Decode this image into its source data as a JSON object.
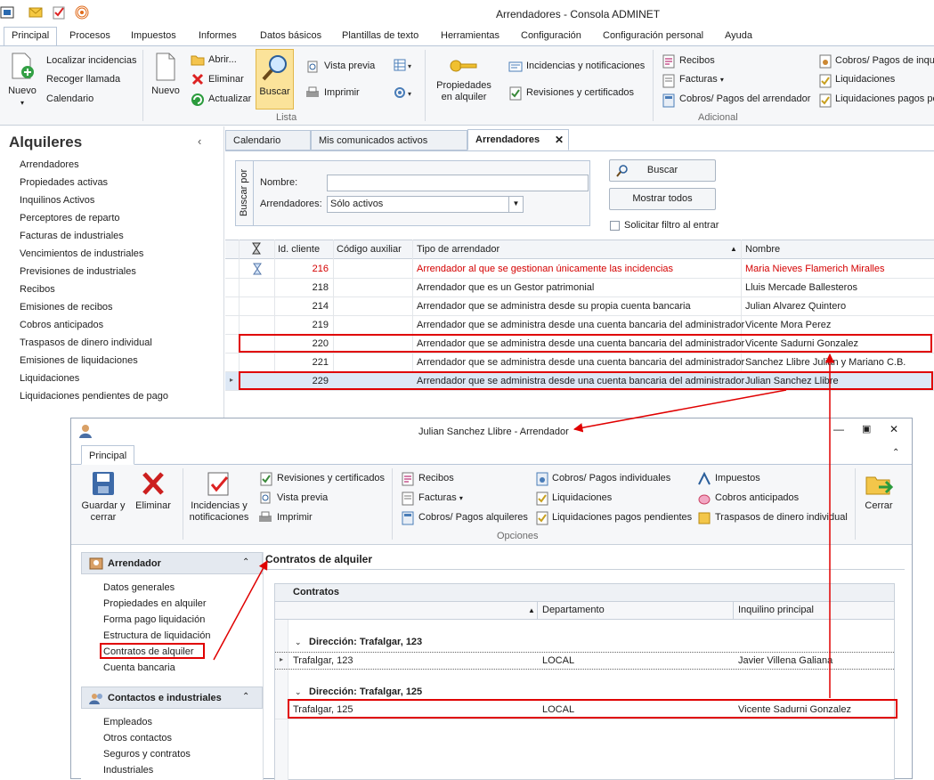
{
  "window": {
    "title": "Arrendadores - Consola ADMINET"
  },
  "ribbon_tabs": [
    "Principal",
    "Procesos",
    "Impuestos",
    "Informes",
    "Datos básicos",
    "Plantillas de texto",
    "Herramientas",
    "Configuración",
    "Configuración personal",
    "Ayuda"
  ],
  "ribbon": {
    "nuevo1": "Nuevo",
    "localizar": "Localizar incidencias",
    "recoger": "Recoger llamada",
    "calendario": "Calendario",
    "nuevo2": "Nuevo",
    "abrir": "Abrir...",
    "eliminar": "Eliminar",
    "actualizar": "Actualizar",
    "buscar": "Buscar",
    "vista_previa": "Vista previa",
    "imprimir": "Imprimir",
    "lista": "Lista",
    "propiedades": "Propiedades en alquiler",
    "incidencias": "Incidencias y notificaciones",
    "revisiones": "Revisiones y certificados",
    "recibos": "Recibos",
    "facturas": "Facturas",
    "cobros_arr": "Cobros/ Pagos del arrendador",
    "adicional": "Adicional",
    "cobros_inq": "Cobros/ Pagos de inqui",
    "liquidaciones": "Liquidaciones",
    "liq_pend": "Liquidaciones pagos pe"
  },
  "left_panel": {
    "title": "Alquileres",
    "items": [
      "Arrendadores",
      "Propiedades activas",
      "Inquilinos Activos",
      "Perceptores de reparto",
      "Facturas de industriales",
      "Vencimientos de industriales",
      "Previsiones de industriales",
      "Recibos",
      "Emisiones de recibos",
      "Cobros anticipados",
      "Traspasos de dinero individual",
      "Emisiones de liquidaciones",
      "Liquidaciones",
      "Liquidaciones pendientes de pago"
    ]
  },
  "doc_tabs": [
    "Calendario",
    "Mis comunicados activos",
    "Arrendadores"
  ],
  "search": {
    "caption": "Buscar por",
    "nombre_label": "Nombre:",
    "nombre_value": "",
    "arr_label": "Arrendadores:",
    "arr_value": "Sólo activos",
    "buscar": "Buscar",
    "mostrar": "Mostrar todos",
    "solicitar": "Solicitar filtro al entrar"
  },
  "grid": {
    "columns": [
      "Id. cliente",
      "Código auxiliar",
      "Tipo de arrendador",
      "Nombre"
    ],
    "rows": [
      {
        "id": "216",
        "tipo": "Arrendador al que se gestionan únicamente las incidencias",
        "nombre": "Maria Nieves Flamerich Miralles"
      },
      {
        "id": "218",
        "tipo": "Arrendador que es un Gestor patrimonial",
        "nombre": "Lluis Mercade Ballesteros"
      },
      {
        "id": "214",
        "tipo": "Arrendador que se administra desde su propia cuenta bancaria",
        "nombre": "Julian Alvarez Quintero"
      },
      {
        "id": "219",
        "tipo": "Arrendador que se administra desde una cuenta bancaria del administrador",
        "nombre": "Vicente Mora Perez"
      },
      {
        "id": "220",
        "tipo": "Arrendador que se administra desde una cuenta bancaria del administrador",
        "nombre": "Vicente Sadurni Gonzalez"
      },
      {
        "id": "221",
        "tipo": "Arrendador que se administra desde una cuenta bancaria del administrador",
        "nombre": "Sanchez Llibre Julian y Mariano C.B."
      },
      {
        "id": "229",
        "tipo": "Arrendador que se administra desde una cuenta bancaria del administrador",
        "nombre": "Julian Sanchez Llibre"
      }
    ]
  },
  "dialog": {
    "title": "Julian Sanchez Llibre - Arrendador",
    "tab": "Principal",
    "guardar": "Guardar y cerrar",
    "eliminar": "Eliminar",
    "incidencias": "Incidencias y notificaciones",
    "revisiones": "Revisiones y certificados",
    "vista_previa": "Vista previa",
    "imprimir": "Imprimir",
    "recibos": "Recibos",
    "facturas": "Facturas",
    "cobros_alq": "Cobros/ Pagos alquileres",
    "cobros_ind": "Cobros/ Pagos individuales",
    "liquidaciones": "Liquidaciones",
    "liq_pend": "Liquidaciones pagos pendientes",
    "impuestos": "Impuestos",
    "cobros_ant": "Cobros anticipados",
    "traspasos": "Traspasos de dinero individual",
    "cerrar": "Cerrar",
    "opciones": "Opciones",
    "nav_group1": "Arrendador",
    "nav_items1": [
      "Datos generales",
      "Propiedades en alquiler",
      "Forma pago liquidación",
      "Estructura de liquidación",
      "Contratos de alquiler",
      "Cuenta bancaria"
    ],
    "nav_group2": "Contactos e industriales",
    "nav_items2": [
      "Empleados",
      "Otros contactos",
      "Seguros y contratos",
      "Industriales"
    ],
    "content_title": "Contratos de alquiler",
    "contratos": "Contratos",
    "columns": [
      "Departamento",
      "Inquilino principal"
    ],
    "groups": [
      {
        "label": "Dirección: Trafalgar, 123",
        "row": {
          "dir": "Trafalgar, 123",
          "dep": "LOCAL",
          "inq": "Javier Villena Galiana"
        }
      },
      {
        "label": "Dirección: Trafalgar, 125",
        "row": {
          "dir": "Trafalgar, 125",
          "dep": "LOCAL",
          "inq": "Vicente Sadurni Gonzalez"
        }
      }
    ]
  },
  "colors": {
    "accent": "#e00000",
    "selected": "#dde8f5",
    "ribbon_bg": "#f6f7f9"
  }
}
